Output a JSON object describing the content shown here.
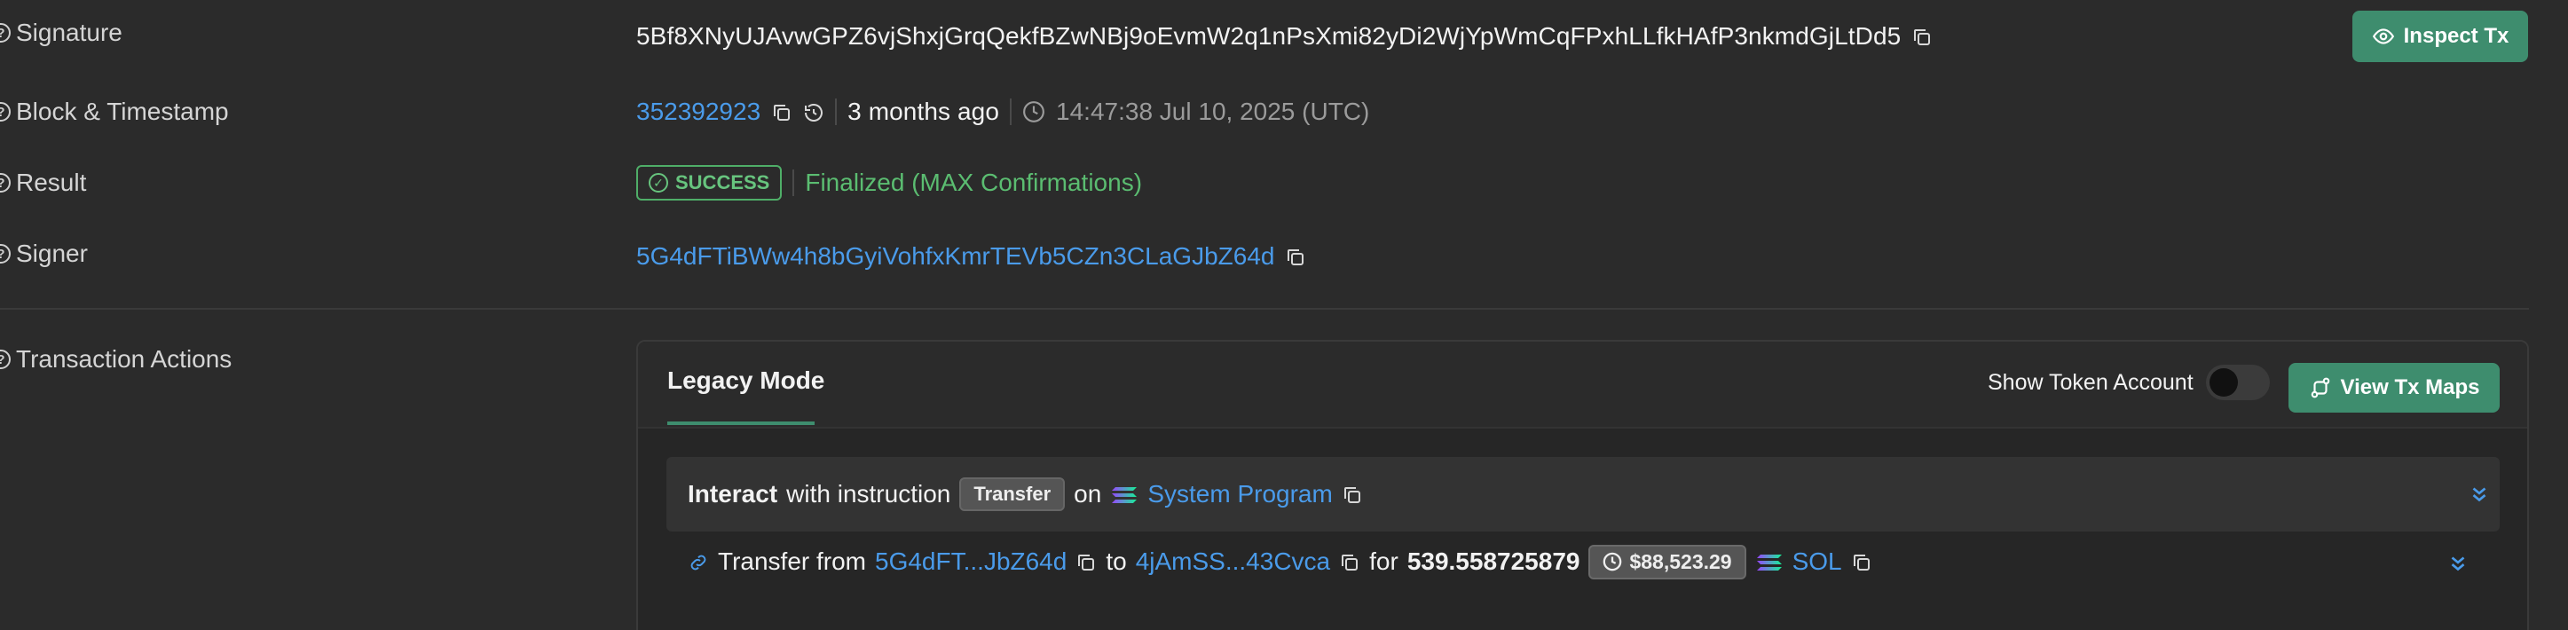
{
  "rows": {
    "signature": {
      "label": "Signature",
      "value": "5Bf8XNyUJAvwGPZ6vjShxjGrqQekfBZwNBj9oEvmW2q1nPsXmi82yDi2WjYpWmCqFPxhLLfkHAfP3nkmdGjLtDd5"
    },
    "block": {
      "label": "Block & Timestamp",
      "block_number": "352392923",
      "relative_time": "3 months ago",
      "timestamp": "14:47:38 Jul 10, 2025 (UTC)"
    },
    "result": {
      "label": "Result",
      "status": "SUCCESS",
      "finality": "Finalized (MAX Confirmations)"
    },
    "signer": {
      "label": "Signer",
      "value": "5G4dFTiBWw4h8bGyiVohfxKmrTEVb5CZn3CLaGJbZ64d"
    },
    "actions": {
      "label": "Transaction Actions"
    }
  },
  "buttons": {
    "inspect_tx": "Inspect Tx",
    "view_tx_maps": "View Tx Maps"
  },
  "panel": {
    "tab": "Legacy Mode",
    "show_token_account": "Show Token Account",
    "instruction": {
      "interact": "Interact",
      "with_instruction": "with instruction",
      "type": "Transfer",
      "on": "on",
      "program": "System Program"
    },
    "transfer": {
      "transfer_from": "Transfer from",
      "from": "5G4dFT...JbZ64d",
      "to_word": "to",
      "to": "4jAmSS...43Cvca",
      "for_word": "for",
      "amount": "539.558725879",
      "usd": "$88,523.29",
      "token": "SOL"
    }
  },
  "colors": {
    "accent": "#3e8d6e",
    "link": "#4a9bea",
    "success": "#5bbd71",
    "background": "#2b2b2b"
  },
  "icons": [
    "help-circle-icon",
    "copy-icon",
    "history-icon",
    "clock-icon",
    "check-circle-icon",
    "eye-icon",
    "route-icon",
    "solana-icon",
    "chevrons-down-icon",
    "link-icon"
  ]
}
